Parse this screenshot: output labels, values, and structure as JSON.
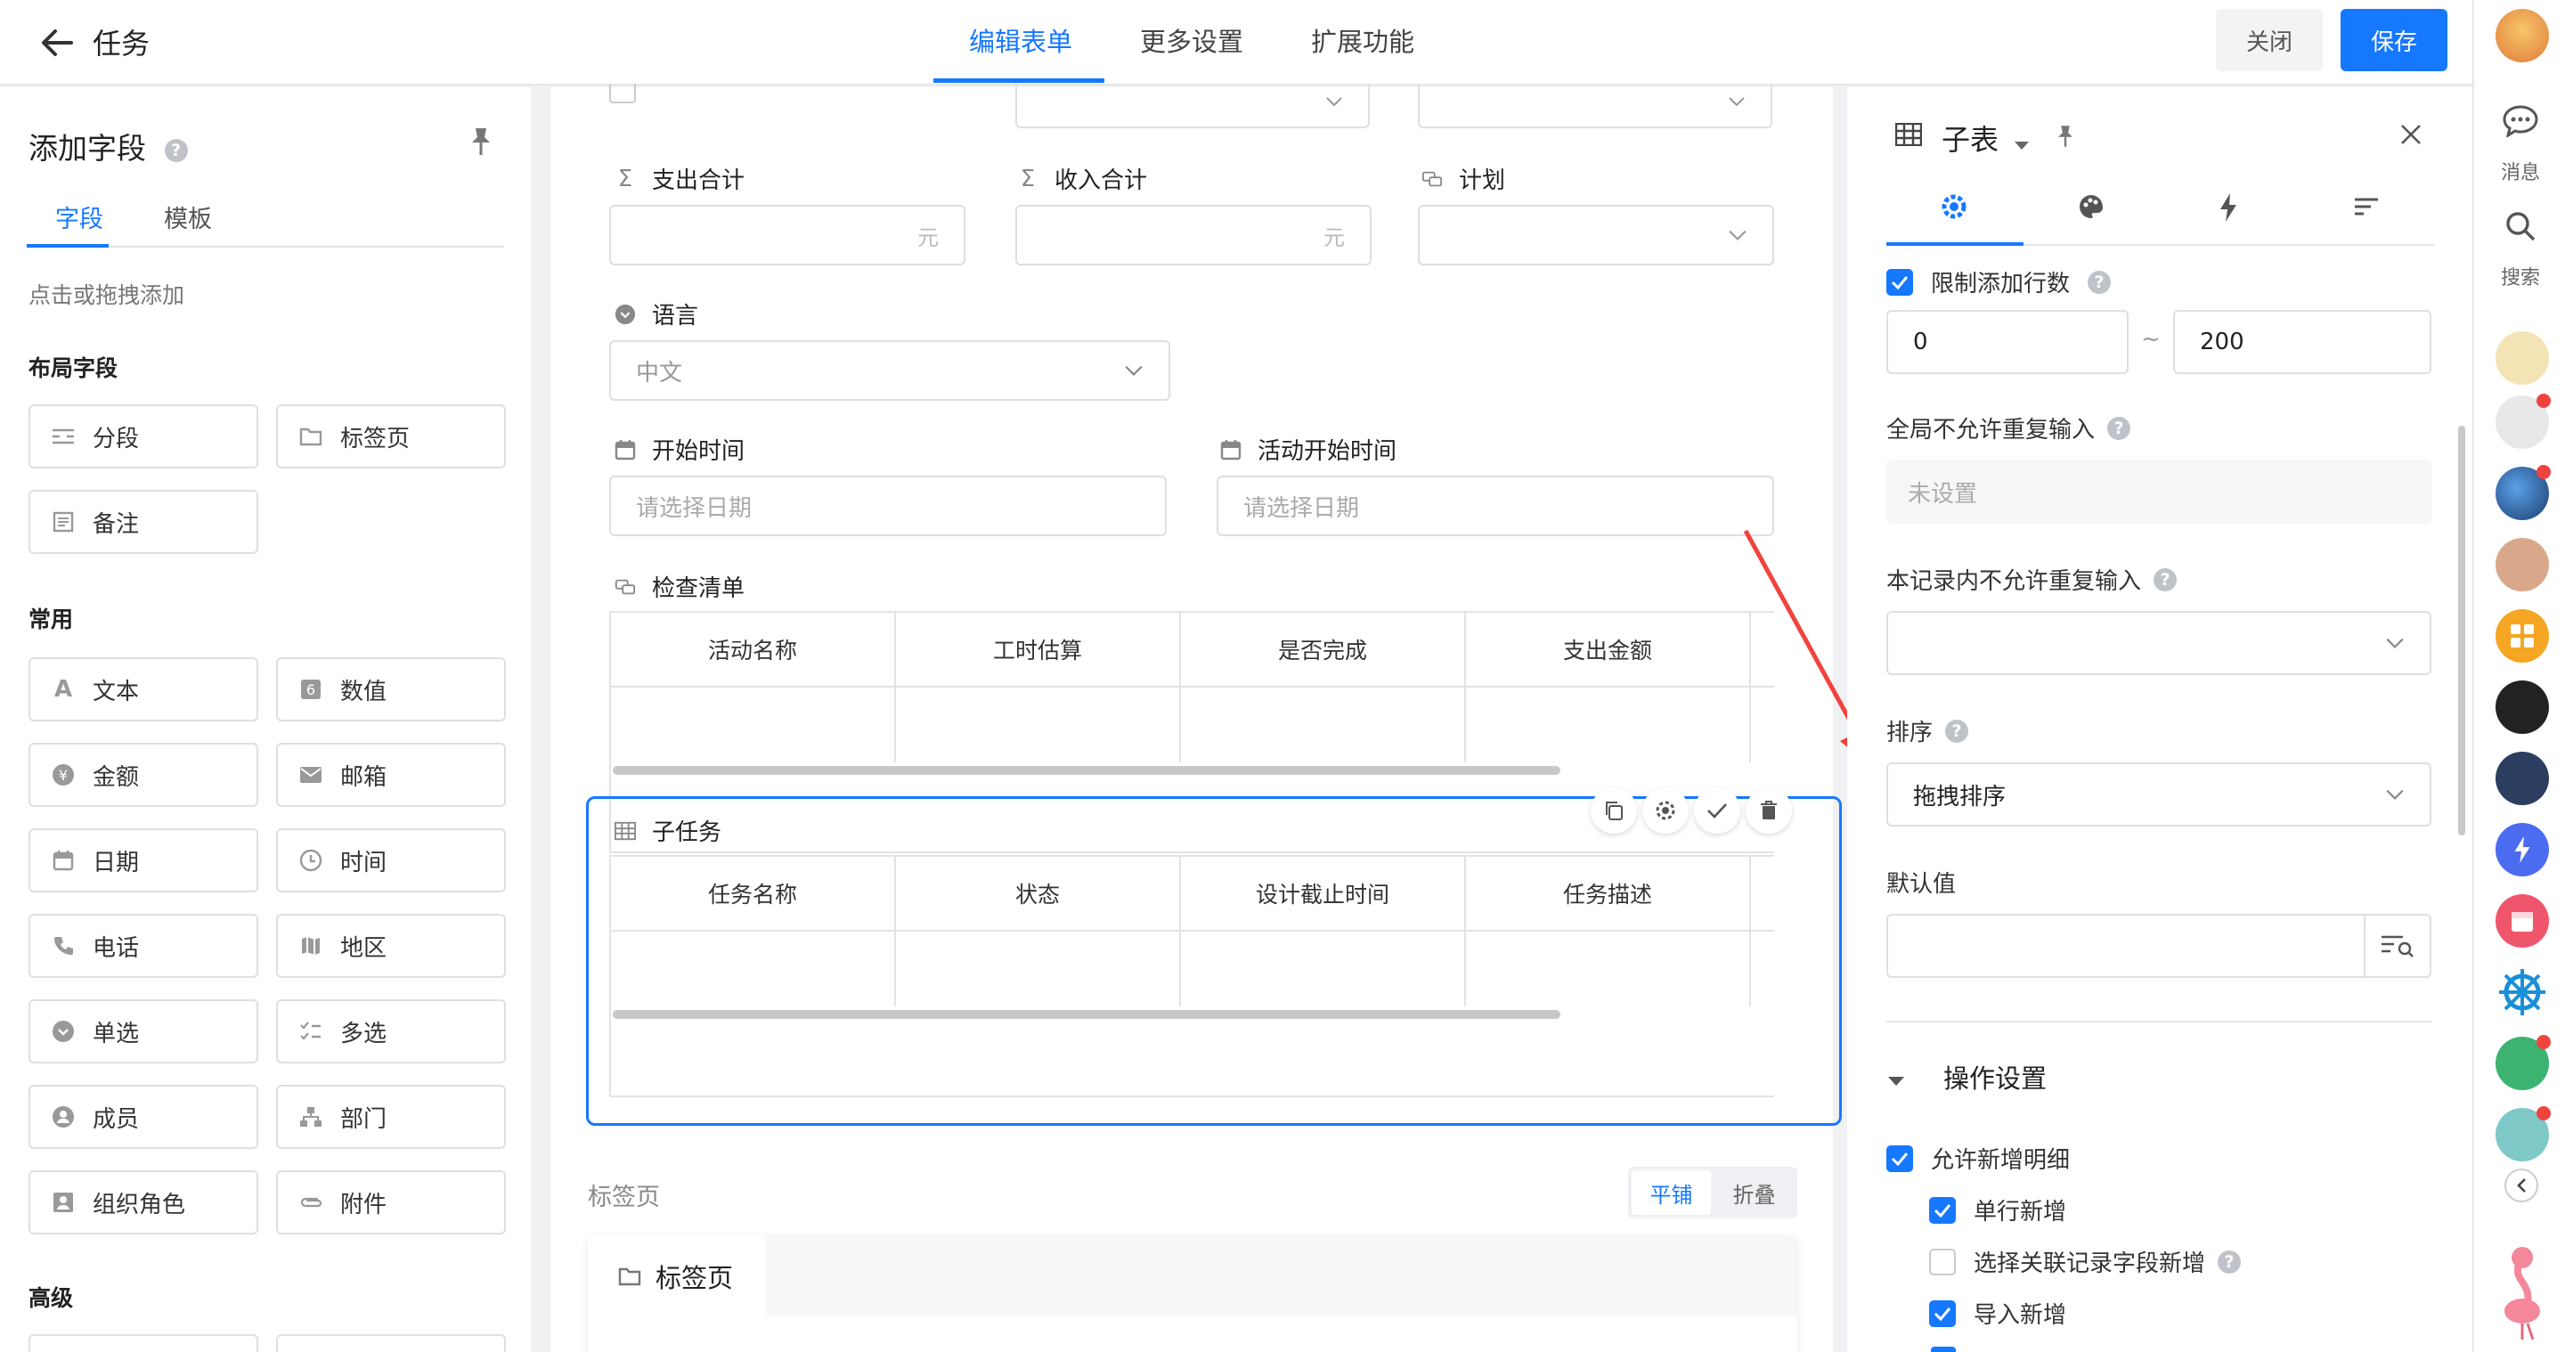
{
  "topbar": {
    "title": "任务",
    "tabs": [
      "编辑表单",
      "更多设置",
      "扩展功能"
    ],
    "close_label": "关闭",
    "save_label": "保存"
  },
  "left_panel": {
    "title": "添加字段",
    "tabs": [
      "字段",
      "模板"
    ],
    "hint": "点击或拖拽添加",
    "sections": {
      "layout": "布局字段",
      "common": "常用",
      "advanced": "高级"
    },
    "layout_fields": [
      "分段",
      "标签页",
      "备注"
    ],
    "common_fields": [
      "文本",
      "数值",
      "金额",
      "邮箱",
      "日期",
      "时间",
      "电话",
      "地区",
      "单选",
      "多选",
      "成员",
      "部门",
      "组织角色",
      "附件"
    ]
  },
  "form": {
    "expense_total": {
      "label": "支出合计",
      "suffix": "元"
    },
    "income_total": {
      "label": "收入合计",
      "suffix": "元"
    },
    "plan": {
      "label": "计划"
    },
    "language": {
      "label": "语言",
      "value": "中文"
    },
    "start_time": {
      "label": "开始时间",
      "placeholder": "请选择日期"
    },
    "activity_start_time": {
      "label": "活动开始时间",
      "placeholder": "请选择日期"
    },
    "checklist": {
      "label": "检查清单",
      "columns": [
        "活动名称",
        "工时估算",
        "是否完成",
        "支出金额"
      ]
    },
    "subtask": {
      "label": "子任务",
      "columns": [
        "任务名称",
        "状态",
        "设计截止时间",
        "任务描述"
      ]
    },
    "tabs_section": {
      "label": "标签页",
      "modes": [
        "平铺",
        "折叠"
      ],
      "tab_label": "标签页"
    }
  },
  "right_panel": {
    "title": "子表",
    "limit_rows": {
      "label": "限制添加行数",
      "min": "0",
      "separator": "~",
      "max": "200"
    },
    "global_unique": {
      "label": "全局不允许重复输入",
      "placeholder": "未设置"
    },
    "record_unique": {
      "label": "本记录内不允许重复输入"
    },
    "sort": {
      "label": "排序",
      "value": "拖拽排序"
    },
    "default_value": {
      "label": "默认值"
    },
    "operations": {
      "title": "操作设置",
      "items": [
        {
          "label": "允许新增明细",
          "checked": true
        },
        {
          "label": "单行新增",
          "checked": true
        },
        {
          "label": "选择关联记录字段新增",
          "checked": false
        },
        {
          "label": "导入新增",
          "checked": true
        }
      ]
    }
  },
  "dock": {
    "messages": "消息",
    "search": "搜索"
  },
  "colors": {
    "accent": "#1678ff",
    "arrow": "#f0433e"
  }
}
